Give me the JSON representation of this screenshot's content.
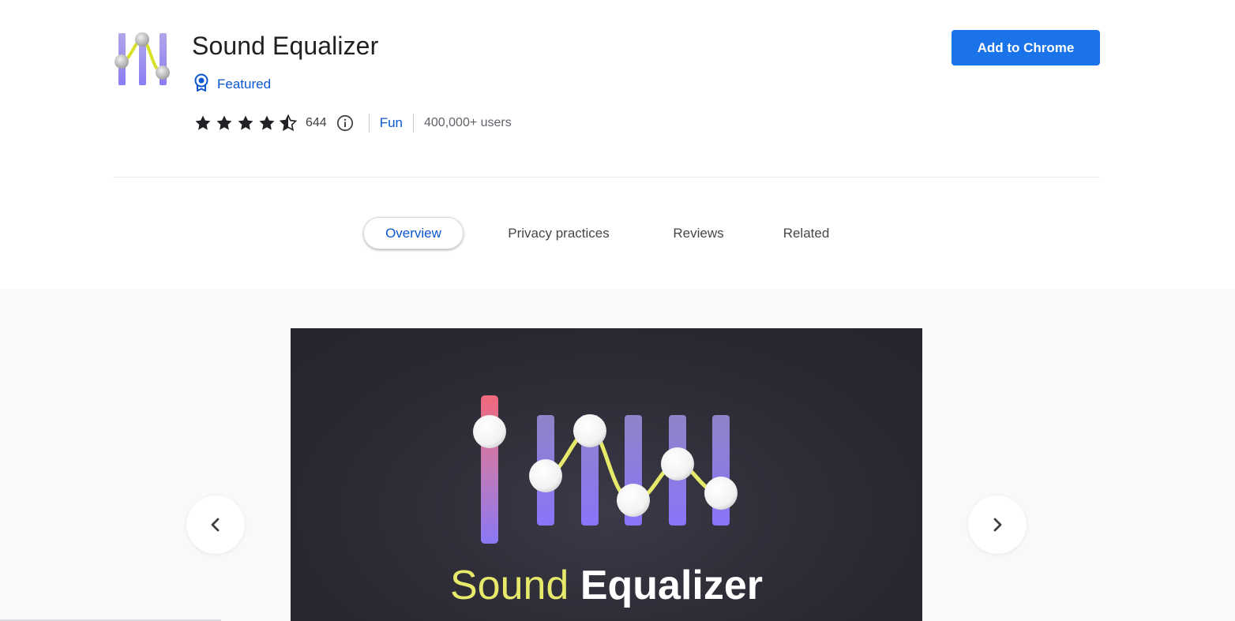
{
  "extension": {
    "title": "Sound Equalizer",
    "featured_label": "Featured",
    "rating_value": 4.5,
    "rating_count": "644",
    "category": "Fun",
    "users": "400,000+ users",
    "add_button": "Add to Chrome"
  },
  "tabs": [
    {
      "label": "Overview",
      "active": true
    },
    {
      "label": "Privacy practices",
      "active": false
    },
    {
      "label": "Reviews",
      "active": false
    },
    {
      "label": "Related",
      "active": false
    }
  ],
  "gallery": {
    "slide_caption_part1": "Sound",
    "slide_caption_part2": "Equalizer",
    "prev_icon": "chevron-left-icon",
    "next_icon": "chevron-right-icon"
  },
  "colors": {
    "accent_blue": "#1a73e8",
    "link_blue": "#0b57d0",
    "slider_purple": "#8a7cf6",
    "curve_yellow": "#e6e96a"
  }
}
